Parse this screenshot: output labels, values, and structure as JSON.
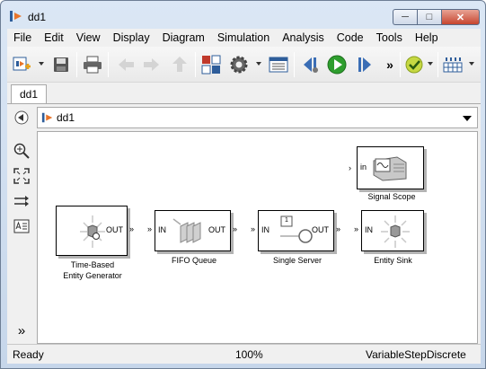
{
  "window": {
    "title": "dd1"
  },
  "menu": [
    "File",
    "Edit",
    "View",
    "Display",
    "Diagram",
    "Simulation",
    "Analysis",
    "Code",
    "Tools",
    "Help"
  ],
  "tabs": [
    "dd1"
  ],
  "address": {
    "path": "dd1"
  },
  "blocks": {
    "generator": {
      "label1": "Time-Based",
      "label2": "Entity Generator",
      "out": "OUT"
    },
    "queue": {
      "label": "FIFO Queue",
      "in": "IN",
      "out": "OUT"
    },
    "server": {
      "label": "Single Server",
      "in": "IN",
      "out": "OUT",
      "count": "1"
    },
    "sink": {
      "label": "Entity Sink",
      "in": "IN"
    },
    "scope": {
      "label": "Signal Scope",
      "in": "in"
    }
  },
  "status": {
    "state": "Ready",
    "zoom": "100%",
    "solver": "VariableStepDiscrete"
  },
  "colors": {
    "run": "#2e9e2e",
    "accent": "#2e5d9a"
  }
}
